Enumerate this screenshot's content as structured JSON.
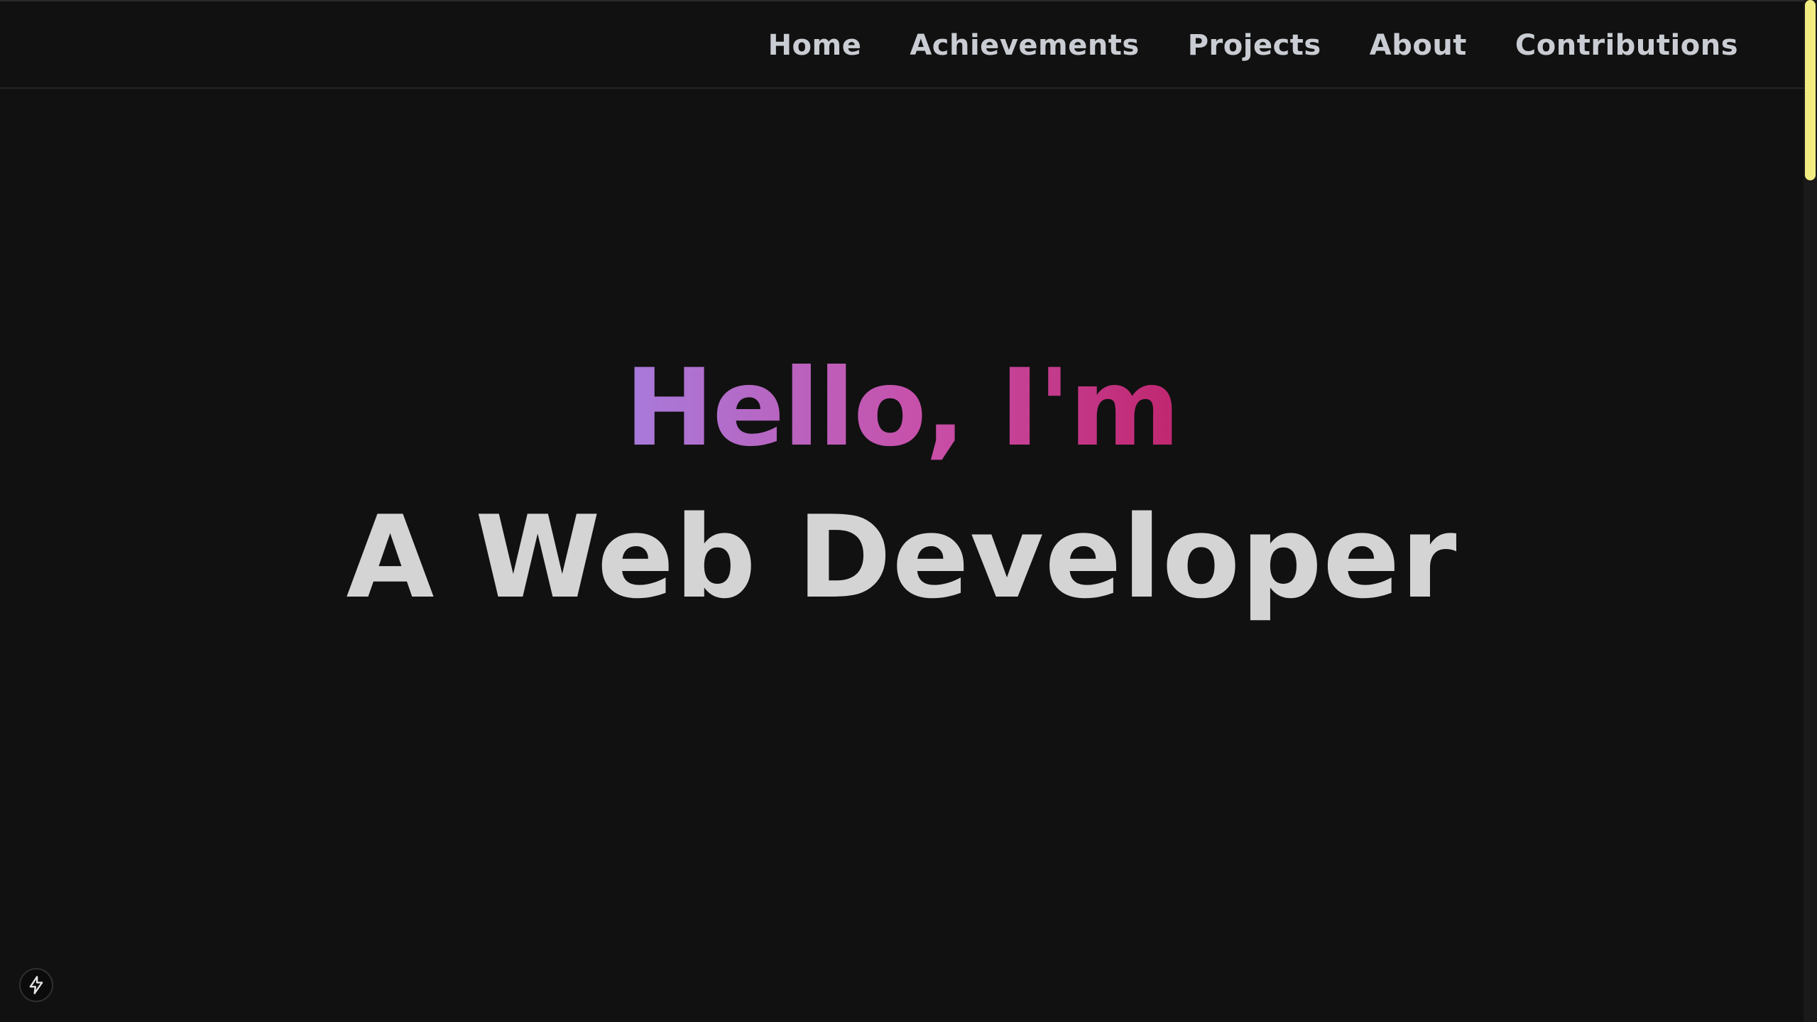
{
  "nav": {
    "items": [
      {
        "label": "Home"
      },
      {
        "label": "Achievements"
      },
      {
        "label": "Projects"
      },
      {
        "label": "About"
      },
      {
        "label": "Contributions"
      }
    ]
  },
  "hero": {
    "greeting": "Hello, I'm",
    "role": "A Web Developer"
  },
  "icons": {
    "floating_button": "lightning-bolt-icon"
  },
  "colors": {
    "background": "#111111",
    "nav_text": "#c9cdd3",
    "greeting_gradient_start": "#a77bdb",
    "greeting_gradient_end": "#c0266f",
    "role_text": "#d4d4d4",
    "scroll_thumb": "#f2ed83"
  }
}
